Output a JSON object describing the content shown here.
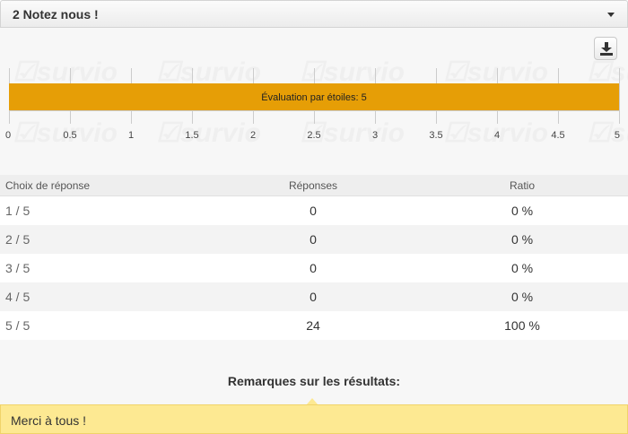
{
  "header": {
    "title": "2 Notez nous !"
  },
  "download": {
    "icon": "download-icon"
  },
  "chart_data": {
    "type": "bar",
    "orientation": "horizontal",
    "categories": [
      ""
    ],
    "values": [
      5
    ],
    "bar_label": "Évaluation par étoiles: 5",
    "xlim": [
      0,
      5
    ],
    "xticks": [
      "0",
      "0.5",
      "1",
      "1.5",
      "2",
      "2.5",
      "3",
      "3.5",
      "4",
      "4.5",
      "5"
    ],
    "bar_color": "#e69e06",
    "grid": true,
    "watermark": "survio"
  },
  "table": {
    "headers": [
      "Choix de réponse",
      "Réponses",
      "Ratio"
    ],
    "rows": [
      [
        "1 / 5",
        "0",
        "0 %"
      ],
      [
        "2 / 5",
        "0",
        "0 %"
      ],
      [
        "3 / 5",
        "0",
        "0 %"
      ],
      [
        "4 / 5",
        "0",
        "0 %"
      ],
      [
        "5 / 5",
        "24",
        "100 %"
      ]
    ]
  },
  "remarks": {
    "title": "Remarques sur les résultats:",
    "note": "Merci à tous !"
  },
  "colors": {
    "note_bg": "#fde992",
    "bar": "#e69e06"
  }
}
